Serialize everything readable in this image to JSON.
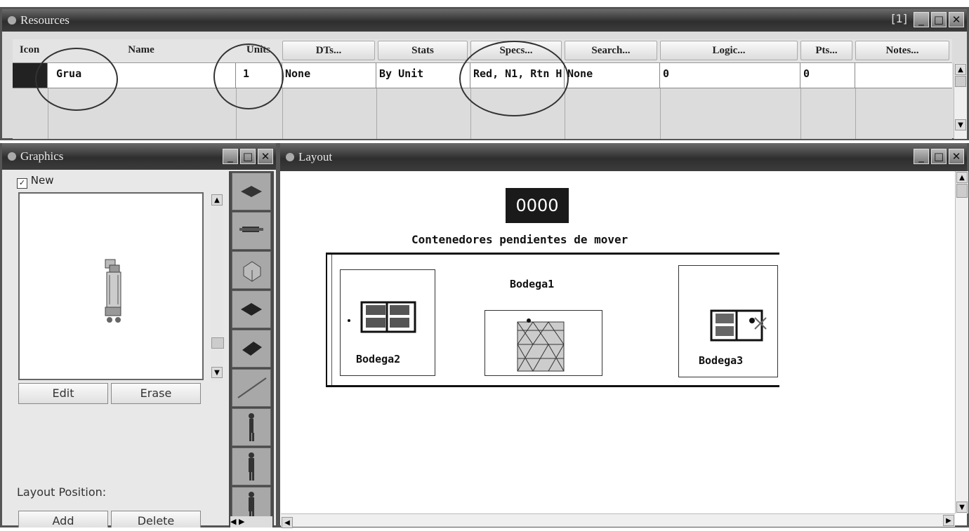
{
  "resources": {
    "title": "Resources",
    "window_buttons": [
      "[1]",
      "_",
      "□",
      "✕"
    ],
    "columns": {
      "icon": "Icon",
      "name": "Name",
      "units": "Units",
      "dts": "DTs...",
      "stats": "Stats",
      "specs": "Specs...",
      "search": "Search...",
      "logic": "Logic...",
      "pts": "Pts...",
      "notes": "Notes..."
    },
    "row": {
      "name": "Grua",
      "units": "1",
      "dts": "None",
      "stats": "By Unit",
      "specs": "Red, N1, Rtn H",
      "search": "None",
      "logic": "0",
      "pts": "0",
      "notes": ""
    }
  },
  "graphics": {
    "title": "Graphics",
    "new_label": "New",
    "new_checked": true,
    "edit_label": "Edit",
    "erase_label": "Erase",
    "layout_position_label": "Layout Position:",
    "add_label": "Add",
    "delete_label": "Delete"
  },
  "layout": {
    "title": "Layout",
    "counter": "0000",
    "pending_label": "Contenedores pendientes de mover",
    "warehouse_main": "Bodega1",
    "warehouse_left": "Bodega2",
    "warehouse_right": "Bodega3"
  },
  "icons": {
    "graphics_title": "graphics-window-icon",
    "resources_title": "resources-window-icon",
    "layout_title": "layout-window-icon",
    "crane": "crane-icon",
    "palette": [
      "pallet-icon",
      "truck-icon",
      "box-icon",
      "pallet-icon",
      "pallet-icon",
      "rail-icon",
      "worker-icon",
      "worker-icon",
      "worker-icon"
    ]
  },
  "colors": {
    "titlebar": "#3c3c3c",
    "counter_bg": "#1a1a1a",
    "counter_fg": "#ffffff",
    "grid_bg": "#dcdcdc"
  }
}
